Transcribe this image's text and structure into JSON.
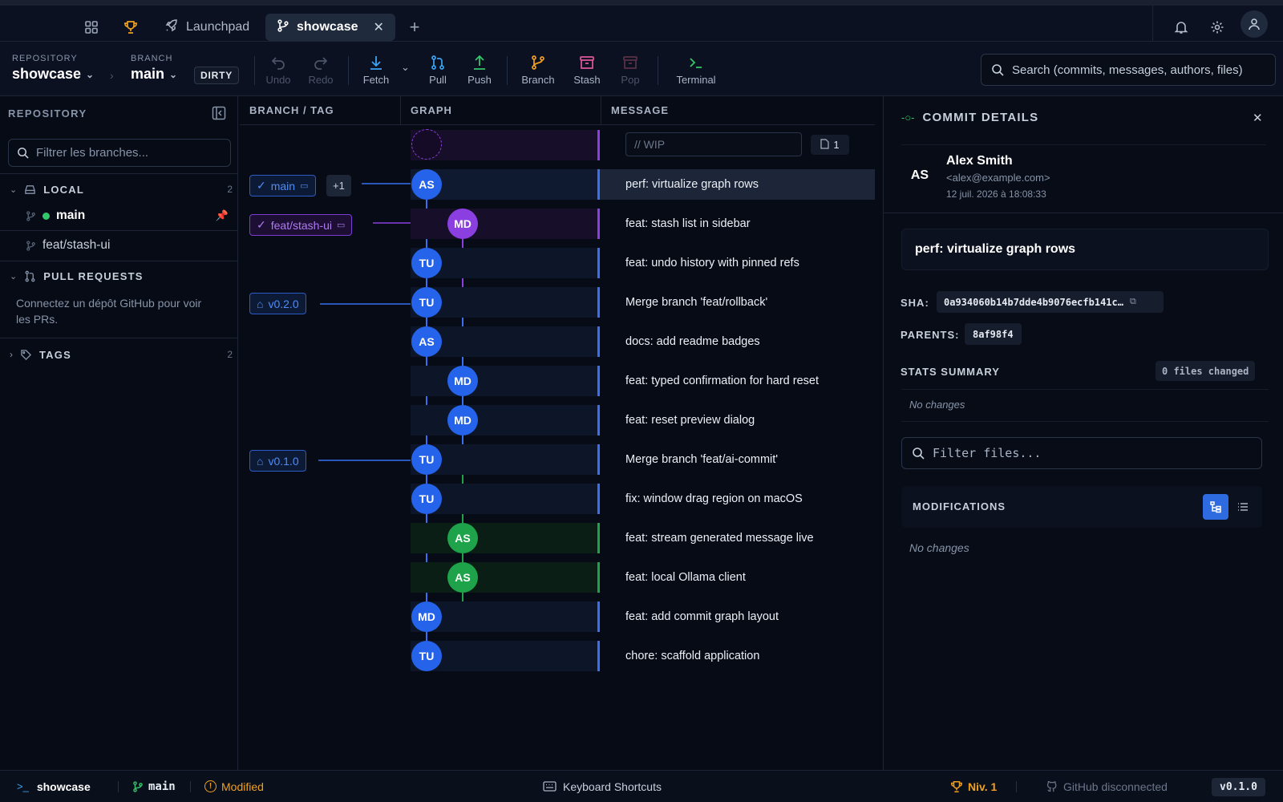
{
  "tabs": {
    "launchpad": "Launchpad",
    "showcase": "showcase"
  },
  "toolbar": {
    "repo_label": "REPOSITORY",
    "repo_name": "showcase",
    "branch_label": "BRANCH",
    "branch_name": "main",
    "dirty": "DIRTY",
    "undo": "Undo",
    "redo": "Redo",
    "fetch": "Fetch",
    "pull": "Pull",
    "push": "Push",
    "branch": "Branch",
    "stash": "Stash",
    "pop": "Pop",
    "terminal": "Terminal",
    "search_placeholder": "Search (commits, messages, authors, files)"
  },
  "sidebar": {
    "title": "REPOSITORY",
    "filter_placeholder": "Filtrer les branches...",
    "local_title": "LOCAL",
    "local_count": "2",
    "branches": [
      "main",
      "feat/stash-ui"
    ],
    "pr_title": "PULL REQUESTS",
    "pr_text": "Connectez un dépôt GitHub pour voir les PRs.",
    "tags_title": "TAGS",
    "tags_count": "2"
  },
  "graph": {
    "col_branch": "BRANCH / TAG",
    "col_graph": "GRAPH",
    "col_message": "MESSAGE",
    "wip_placeholder": "// WIP",
    "wip_count": "1",
    "refs": {
      "main": "main",
      "main_extra": "+1",
      "feat": "feat/stash-ui",
      "tag2": "v0.2.0",
      "tag1": "v0.1.0"
    },
    "commits": [
      {
        "initials": "AS",
        "message": "perf: virtualize graph rows"
      },
      {
        "initials": "MD",
        "message": "feat: stash list in sidebar"
      },
      {
        "initials": "TU",
        "message": "feat: undo history with pinned refs"
      },
      {
        "initials": "TU",
        "message": "Merge branch 'feat/rollback'"
      },
      {
        "initials": "AS",
        "message": "docs: add readme badges"
      },
      {
        "initials": "MD",
        "message": "feat: typed confirmation for hard reset"
      },
      {
        "initials": "MD",
        "message": "feat: reset preview dialog"
      },
      {
        "initials": "TU",
        "message": "Merge branch 'feat/ai-commit'"
      },
      {
        "initials": "TU",
        "message": "fix: window drag region on macOS"
      },
      {
        "initials": "AS",
        "message": "feat: stream generated message live"
      },
      {
        "initials": "AS",
        "message": "feat: local Ollama client"
      },
      {
        "initials": "MD",
        "message": "feat: add commit graph layout"
      },
      {
        "initials": "TU",
        "message": "chore: scaffold application"
      }
    ]
  },
  "details": {
    "title": "COMMIT DETAILS",
    "author_initials": "AS",
    "author_name": "Alex Smith",
    "author_email": "<alex@example.com>",
    "date": "12 juil. 2026 à 18:08:33",
    "subject": "perf: virtualize graph rows",
    "sha_label": "SHA:",
    "sha": "0a934060b14b7dde4b9076ecfb141c…",
    "parents_label": "PARENTS:",
    "parent": "8af98f4",
    "stats_label": "STATS SUMMARY",
    "files_changed": "0 files changed",
    "no_changes": "No changes",
    "filter_placeholder": "Filter files...",
    "modifications": "MODIFICATIONS"
  },
  "status": {
    "repo": "showcase",
    "branch": "main",
    "modified": "Modified",
    "shortcuts": "Keyboard Shortcuts",
    "level": "Niv. 1",
    "github": "GitHub disconnected",
    "version": "v0.1.0"
  },
  "colors": {
    "accent": "#3a6ff0",
    "purple": "#8b3fe0",
    "green": "#1ea34a",
    "dirty_orange": "#f0a020"
  }
}
